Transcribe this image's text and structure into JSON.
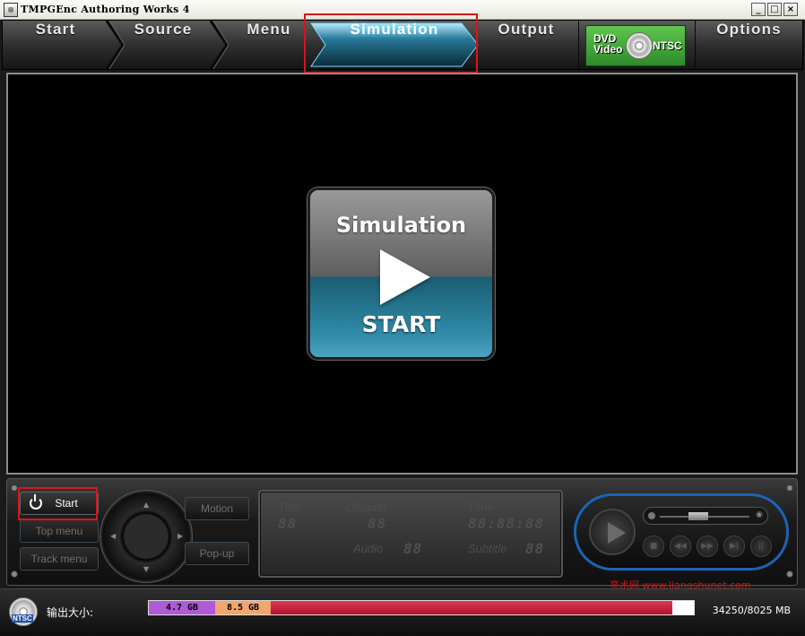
{
  "window": {
    "title": "TMPGEnc Authoring Works 4",
    "app_icon": "film-icon",
    "minimize": "_",
    "maximize": "□",
    "close": "×"
  },
  "nav": {
    "tabs": [
      {
        "label": "Start"
      },
      {
        "label": "Source"
      },
      {
        "label": "Menu"
      },
      {
        "label": "Simulation",
        "active": true
      },
      {
        "label": "Output"
      },
      {
        "label": "Options"
      }
    ],
    "format_badge": {
      "line1": "DVD",
      "line2": "Video",
      "standard": "NTSC",
      "icon": "disc-icon"
    },
    "accent": "#5cd2ff"
  },
  "preview": {
    "title": "Simulation",
    "action": "START",
    "icon": "play-icon"
  },
  "controls": {
    "start": "Start",
    "top_menu": "Top menu",
    "track_menu": "Track menu",
    "motion": "Motion",
    "popup": "Pop-up",
    "lcd": {
      "title_label": "Title",
      "title_value": "88",
      "chapter_label": "Chapter",
      "chapter_value": "88",
      "time_label": "Time",
      "time_value": "88:88:88",
      "audio_label": "Audio",
      "audio_value": "88",
      "subtitle_label": "Subtitle",
      "subtitle_value": "88"
    },
    "player_ring_color": "#1b64b8"
  },
  "watermark": "亮术网 www.liangshunet.com",
  "status": {
    "disc_label": "NTSC",
    "size_label": "输出大小:",
    "seg1": "4.7 GB",
    "seg2": "8.5 GB",
    "used_fraction": 0.96,
    "size_value": "34250/8025 MB",
    "colors": {
      "seg1": "#b05ad6",
      "seg2": "#f2a56d",
      "fill": "#b1122e"
    }
  }
}
